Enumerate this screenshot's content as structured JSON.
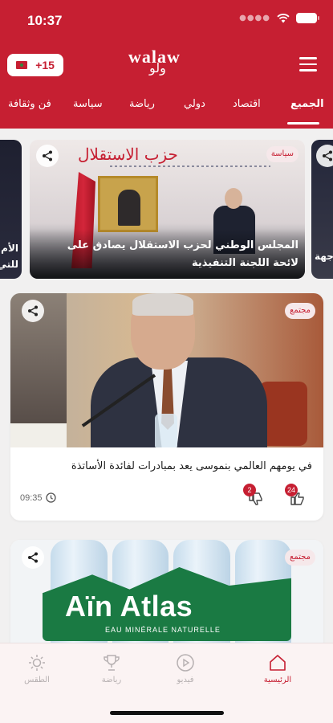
{
  "status": {
    "time": "10:37"
  },
  "header": {
    "age_badge": "+15",
    "logo": {
      "primary": "walaw",
      "secondary": "ولو"
    },
    "categories": [
      "الجميع",
      "اقتصاد",
      "دولي",
      "رياضة",
      "سياسة",
      "فن وثقافة"
    ],
    "active_category": "الجميع"
  },
  "carousel": {
    "main": {
      "banner": "حزب الاستقلال",
      "tag": "سياسة",
      "title": "المجلس الوطني لحزب الاستقلال يصادق على لائحة اللجنة التنفيذية"
    },
    "left_snippet": "الأم للتي",
    "right_snippet": "جهة"
  },
  "news": [
    {
      "tag": "مجتمع",
      "title": "في يومهم العالمي بنموسى يعد بمبادرات لفائدة الأساتذة",
      "time": "09:35",
      "likes": "24",
      "dislikes": "2"
    },
    {
      "tag": "مجتمع",
      "image_brand": "Aïn Atlas",
      "image_subtitle": "EAU MINÉRALE NATURELLE"
    }
  ],
  "tabbar": {
    "items": [
      {
        "label": "الرئيسية",
        "icon": "home-icon",
        "active": true
      },
      {
        "label": "فيديو",
        "icon": "play-icon",
        "active": false
      },
      {
        "label": "رياضة",
        "icon": "trophy-icon",
        "active": false
      },
      {
        "label": "الطقس",
        "icon": "sun-icon",
        "active": false
      }
    ]
  },
  "colors": {
    "brand": "#c61f32",
    "inactive": "#b6b0b1"
  }
}
